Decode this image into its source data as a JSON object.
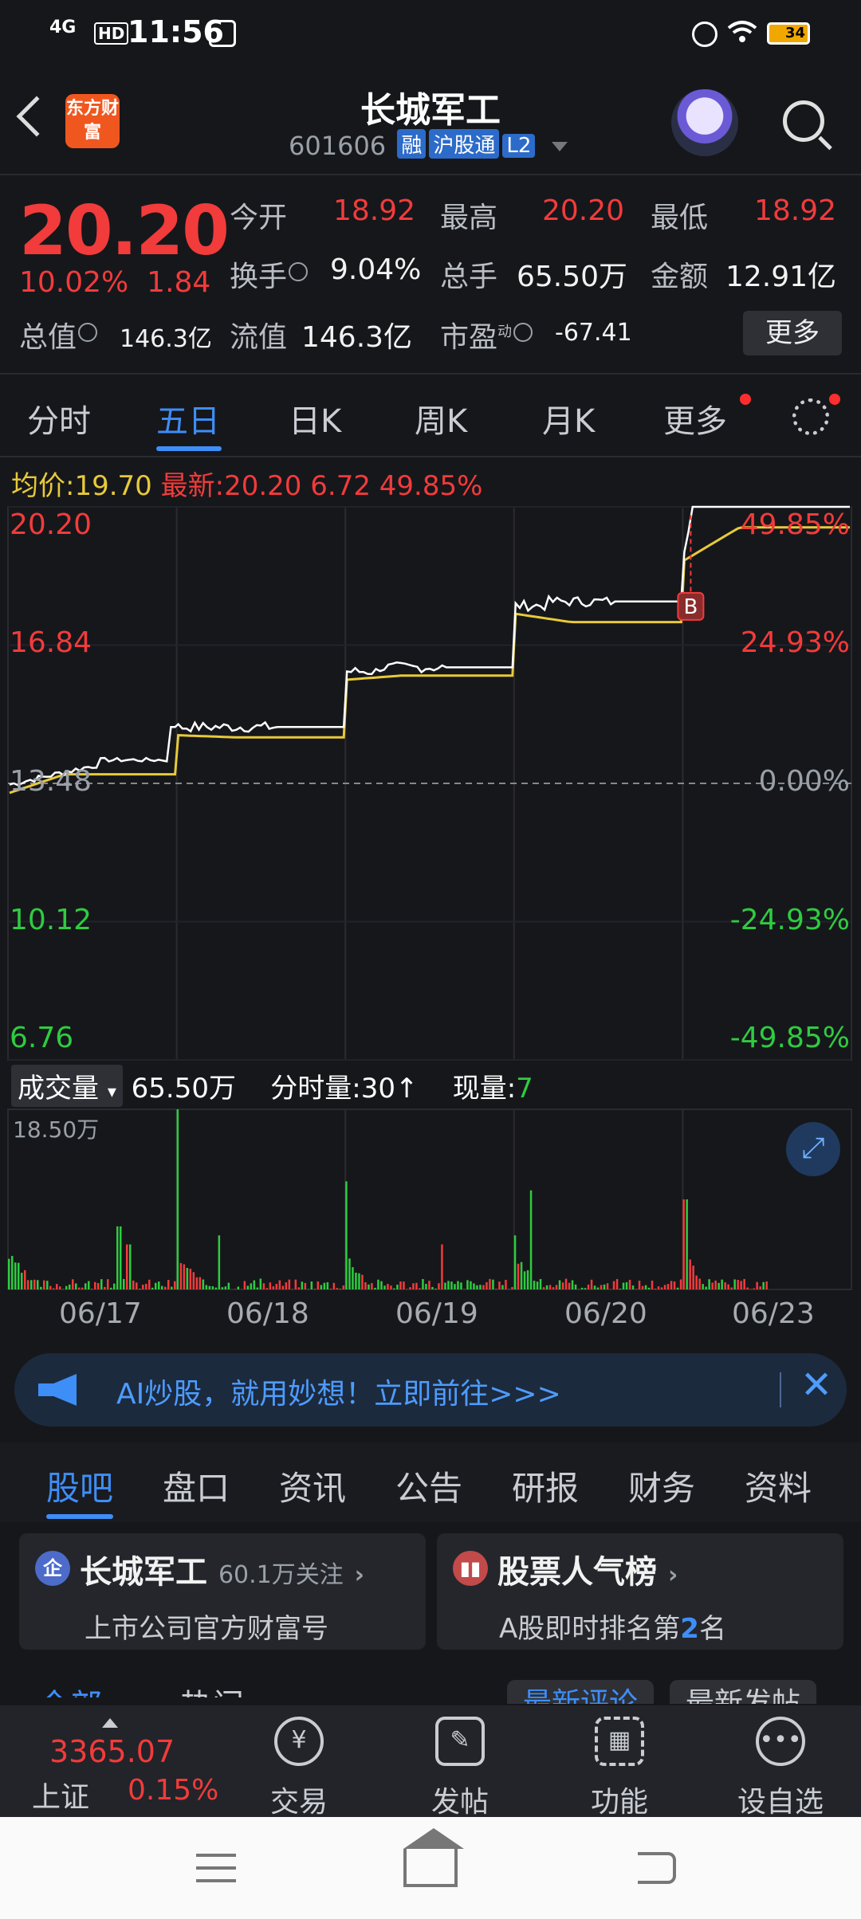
{
  "status": {
    "network": "4G",
    "hd": "HD",
    "time": "11:56",
    "battery": "34"
  },
  "header": {
    "app_logo": "东方财富",
    "title": "长城军工",
    "code": "601606",
    "tags": [
      "融",
      "沪股通",
      "L2"
    ]
  },
  "quote": {
    "price": "20.20",
    "change_pct": "10.02%",
    "change": "1.84",
    "open_label": "今开",
    "open": "18.92",
    "high_label": "最高",
    "high": "20.20",
    "low_label": "最低",
    "low": "18.92",
    "turnover_label": "换手",
    "turnover": "9.04%",
    "volume_label": "总手",
    "volume": "65.50万",
    "amount_label": "金额",
    "amount": "12.91亿",
    "mktcap_label": "总值",
    "mktcap": "146.3亿",
    "float_label": "流值",
    "float": "146.3亿",
    "pe_label": "市盈",
    "pe_sup": "动",
    "pe": "-67.41",
    "more": "更多"
  },
  "tabs": [
    "分时",
    "五日",
    "日K",
    "周K",
    "月K",
    "更多"
  ],
  "active_tab": 1,
  "avg": {
    "label": "均价:",
    "value": "19.70",
    "latest_label": "最新:",
    "latest": "20.20",
    "change": "6.72",
    "pct": "49.85%"
  },
  "chart_data": {
    "type": "line",
    "title": "",
    "x": [
      "06/17",
      "06/18",
      "06/19",
      "06/20",
      "06/23"
    ],
    "y_left_ticks": [
      "20.20",
      "16.84",
      "13.48",
      "10.12",
      "6.76"
    ],
    "y_right_ticks": [
      "49.85%",
      "24.93%",
      "0.00%",
      "-24.93%",
      "-49.85%"
    ],
    "ylim": [
      6.76,
      20.2
    ],
    "reference": 13.48,
    "series": [],
    "volume": {
      "label": "成交量",
      "total": "65.50万",
      "per_min": "分时量:30",
      "per_min_arrow": "↑",
      "current_label": "现量:",
      "current": "7",
      "max_label": "18.50万"
    },
    "marker": "B"
  },
  "colors": {
    "up": "#f23b3b",
    "down": "#2ecc40",
    "accent": "#3e8ef7",
    "price_line": "#ffffff",
    "avg_line": "#e8c93a"
  },
  "banner": {
    "text": "AI炒股，就用妙想！立即前往>>>"
  },
  "lower_tabs": [
    "股吧",
    "盘口",
    "资讯",
    "公告",
    "研报",
    "财务",
    "资料"
  ],
  "cards": [
    {
      "icon": "企",
      "title": "长城军工",
      "sub": "60.1万关注",
      "desc": "上市公司官方财富号"
    },
    {
      "title": "股票人气榜",
      "desc_a": "A股即时排名第",
      "rank": "2",
      "desc_b": "名"
    }
  ],
  "peek": {
    "all": "全部",
    "hot": "热门",
    "latest_reply": "最新评论",
    "latest_post": "最新发帖"
  },
  "bottom": {
    "index_value": "3365.07",
    "index_name": "上证",
    "index_pct": "0.15%",
    "items": [
      "交易",
      "发帖",
      "功能",
      "设自选"
    ],
    "trade_icon": "¥"
  }
}
